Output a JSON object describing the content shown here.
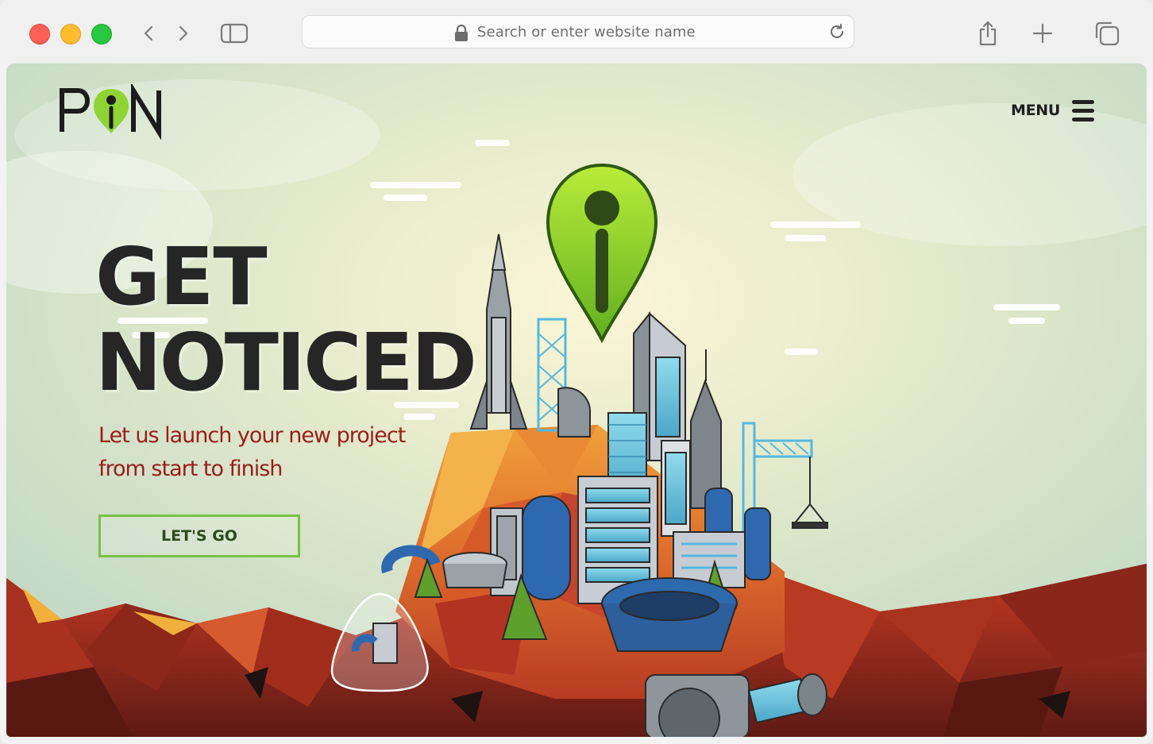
{
  "browser": {
    "url_placeholder": "Search or enter website name"
  },
  "site": {
    "logo_text": "PIN",
    "menu_label": "MENU",
    "headline_line1": "GET",
    "headline_line2": "NOTICED",
    "tagline_line1": "Let us launch your new project",
    "tagline_line2": "from start to finish",
    "cta_label": "LET'S GO"
  },
  "colors": {
    "accent_green": "#7ac143",
    "tagline_red": "#9b1d1a",
    "headline_dark": "#262626"
  }
}
